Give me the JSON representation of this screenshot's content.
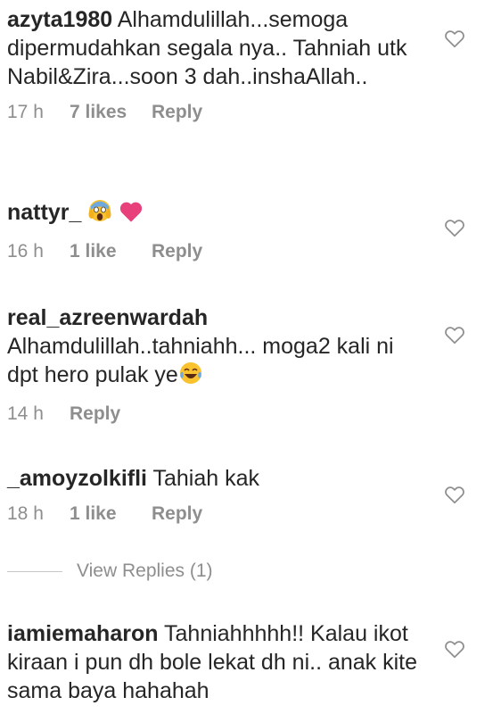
{
  "comments": [
    {
      "username": "azyta1980",
      "text": "Alhamdulillah...semoga dipermudahkan segala nya.. Tahniah utk Nabil&Zira...soon 3 dah..inshaAllah..",
      "time": "17 h",
      "likes": "7 likes",
      "reply": "Reply"
    },
    {
      "username": "nattyr_",
      "text": "",
      "time": "16 h",
      "likes": "1 like",
      "reply": "Reply",
      "emojis": [
        "screaming-face-emoji",
        "pink-heart-emoji"
      ]
    },
    {
      "username": "real_azreenwardah",
      "text": "Alhamdulillah..tahniahh... moga2 kali ni dpt hero pulak ye",
      "time": "14 h",
      "likes": "",
      "reply": "Reply",
      "emojis": [
        "tears-of-joy-face-emoji"
      ]
    },
    {
      "username": "_amoyzolkifli",
      "text": "Tahiah kak",
      "time": "18 h",
      "likes": "1 like",
      "reply": "Reply"
    },
    {
      "username": "iamiemaharon",
      "text": "Tahniahhhhh!! Kalau ikot kiraan i pun dh bole lekat dh ni.. anak kite sama baya hahahah"
    }
  ],
  "view_replies": {
    "label": "View Replies (1)"
  },
  "icons": {
    "heart": "heart-outline-icon"
  },
  "colors": {
    "text": "#262626",
    "meta": "#8e8e8e",
    "heart_emoji": "#e8407a",
    "emoji_yellow": "#f9c22e"
  }
}
